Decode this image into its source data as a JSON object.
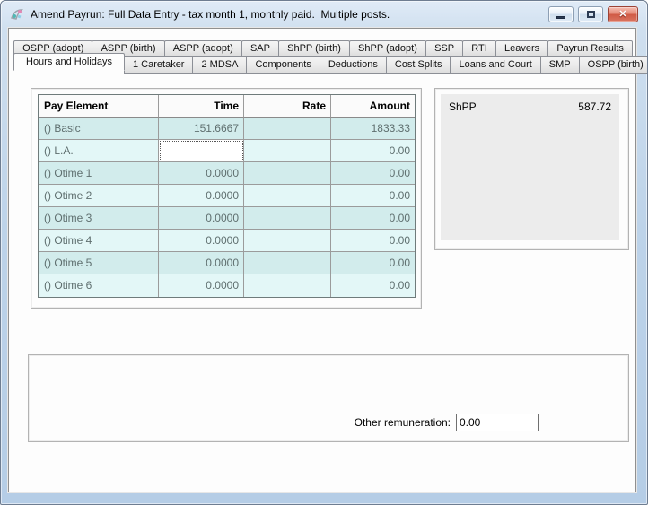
{
  "window": {
    "title": "Amend Payrun: Full Data Entry - tax month 1, monthly paid.  Multiple posts.",
    "controls": {
      "minimize": "minimize",
      "restore": "restore",
      "close": "close"
    }
  },
  "tabs": {
    "row1": [
      "OSPP (adopt)",
      "ASPP (birth)",
      "ASPP (adopt)",
      "SAP",
      "ShPP (birth)",
      "ShPP (adopt)",
      "SSP",
      "RTI",
      "Leavers",
      "Payrun Results"
    ],
    "row2": [
      {
        "label": "Hours and Holidays",
        "selected": true
      },
      {
        "label": "1 Caretaker"
      },
      {
        "label": "2 MDSA"
      },
      {
        "label": "Components"
      },
      {
        "label": "Deductions"
      },
      {
        "label": "Cost Splits"
      },
      {
        "label": "Loans and Court"
      },
      {
        "label": "SMP"
      },
      {
        "label": "OSPP (birth)"
      }
    ]
  },
  "pay_table": {
    "columns": [
      "Pay Element",
      "Time",
      "Rate",
      "Amount"
    ],
    "rows": [
      {
        "element": "() Basic",
        "time": "151.6667",
        "rate": "",
        "amount": "1833.33"
      },
      {
        "element": "() L.A.",
        "time": "",
        "rate": "",
        "amount": "0.00",
        "editing": true
      },
      {
        "element": "() Otime 1",
        "time": "0.0000",
        "rate": "",
        "amount": "0.00"
      },
      {
        "element": "() Otime 2",
        "time": "0.0000",
        "rate": "",
        "amount": "0.00"
      },
      {
        "element": "() Otime 3",
        "time": "0.0000",
        "rate": "",
        "amount": "0.00"
      },
      {
        "element": "() Otime 4",
        "time": "0.0000",
        "rate": "",
        "amount": "0.00"
      },
      {
        "element": "() Otime 5",
        "time": "0.0000",
        "rate": "",
        "amount": "0.00"
      },
      {
        "element": "() Otime 6",
        "time": "0.0000",
        "rate": "",
        "amount": "0.00"
      }
    ]
  },
  "summary_panel": {
    "label": "ShPP",
    "value": "587.72"
  },
  "footer": {
    "other_remuneration_label": "Other remuneration:",
    "other_remuneration_value": "0.00"
  },
  "colors": {
    "row_odd": "#d2ecec",
    "row_even": "#e3f7f7",
    "close_button": "#d05a45",
    "frame": "#bdd3e9",
    "summary_box": "#ececec"
  }
}
